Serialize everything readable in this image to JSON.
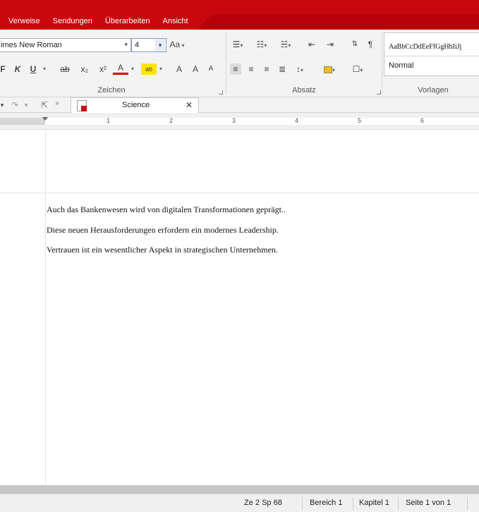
{
  "menu": {
    "tabs": [
      "Verweise",
      "Sendungen",
      "Überarbeiten",
      "Ansicht"
    ]
  },
  "ribbon": {
    "font_name": "imes New Roman",
    "font_size": "4",
    "groups": {
      "font": "Zeichen",
      "paragraph": "Absatz",
      "styles": "Vorlagen"
    },
    "style_sample": "AaBbCcDdEeFfGgHhIiJj",
    "style_name": "Normal",
    "font_buttons": {
      "italic": "K",
      "underline": "U",
      "strike": "ab",
      "subscript": "x₂",
      "superscript": "x²",
      "font_color": "A",
      "highlight": "ab",
      "clear": "A",
      "grow": "A",
      "shrink": "A",
      "case": "Aa"
    }
  },
  "document": {
    "tab_title": "Science",
    "paragraphs": [
      "Auch das Bankenwesen wird von digitalen Transformationen geprägt..",
      "Diese neuen Herausforderungen erfordern ein modernes Leadership.",
      "Vertrauen ist ein wesentlicher Aspekt in strategischen Unternehmen."
    ]
  },
  "ruler": {
    "numbers": [
      "1",
      "2",
      "3",
      "4",
      "5",
      "6"
    ]
  },
  "status": {
    "position": "Ze 2 Sp 68",
    "section": "Bereich 1",
    "chapter": "Kapitel 1",
    "page": "Seite 1 von 1"
  },
  "colors": {
    "accent": "#c8080e",
    "accent_dark": "#b80008",
    "ribbon_bg": "#f3f3f3"
  },
  "icons": [
    "chevron-down-icon",
    "change-case-icon",
    "bullet-list-icon",
    "numbered-list-icon",
    "multilevel-list-icon",
    "indent-decrease-icon",
    "indent-increase-icon",
    "sort-icon",
    "pilcrow-icon",
    "align-left-icon",
    "align-center-icon",
    "align-right-icon",
    "justify-icon",
    "line-spacing-icon",
    "shading-icon",
    "border-icon",
    "undo-icon",
    "redo-icon",
    "pointer-icon",
    "document-icon",
    "close-icon"
  ]
}
